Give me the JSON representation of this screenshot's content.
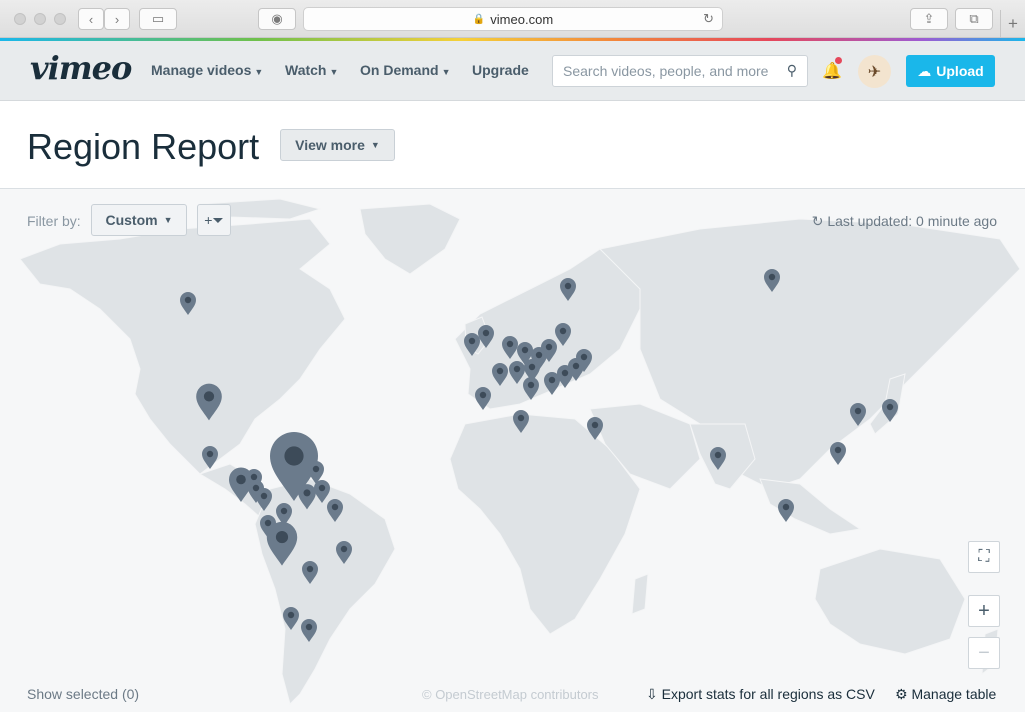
{
  "browser": {
    "url": "vimeo.com",
    "lock_icon": "lock-icon"
  },
  "header": {
    "logo": "vimeo",
    "nav": [
      {
        "label": "Manage videos",
        "has_dropdown": true
      },
      {
        "label": "Watch",
        "has_dropdown": true
      },
      {
        "label": "On Demand",
        "has_dropdown": true
      },
      {
        "label": "Upgrade",
        "has_dropdown": false
      }
    ],
    "search_placeholder": "Search videos, people, and more",
    "upload_label": "Upload",
    "notification_dot_color": "#e5485b",
    "accent_color": "#1ab7ea"
  },
  "page": {
    "title": "Region Report",
    "view_more_label": "View more"
  },
  "map": {
    "filter_label": "Filter by:",
    "filter_value": "Custom",
    "last_updated": "Last updated: 0 minute ago",
    "show_selected": "Show selected (0)",
    "attribution_prefix": "© OpenStreetMap",
    "attribution_suffix": " contributors",
    "export_label": "Export stats for all regions as CSV",
    "manage_label": "Manage table",
    "marker_color": "#6b7b8c"
  }
}
